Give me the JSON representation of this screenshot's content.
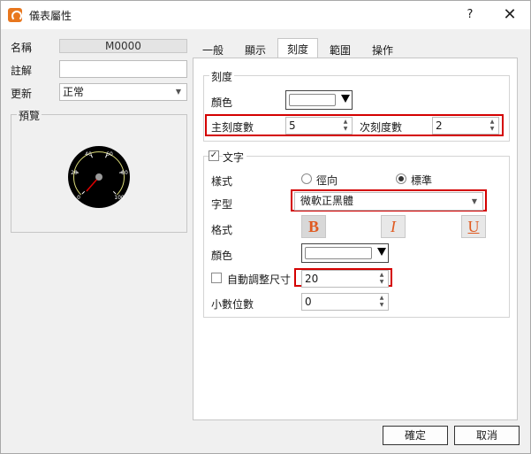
{
  "window": {
    "title": "儀表屬性",
    "help": "?",
    "close": "✕"
  },
  "left": {
    "name_label": "名稱",
    "name_value": "M0000",
    "comment_label": "註解",
    "comment_value": "",
    "update_label": "更新",
    "update_value": "正常",
    "preview_label": "預覽",
    "gauge_ticks": [
      "0",
      "20",
      "40",
      "60",
      "80",
      "100"
    ]
  },
  "tabs": [
    {
      "label": "一般"
    },
    {
      "label": "顯示"
    },
    {
      "label": "刻度"
    },
    {
      "label": "範圍"
    },
    {
      "label": "操作"
    }
  ],
  "scale": {
    "group_label": "刻度",
    "color_label": "顏色",
    "major_label": "主刻度數",
    "major_value": "5",
    "minor_label": "次刻度數",
    "minor_value": "2"
  },
  "text": {
    "group_label": "文字",
    "enabled": true,
    "style_label": "樣式",
    "radial_label": "徑向",
    "standard_label": "標準",
    "selected_style": "標準",
    "font_label": "字型",
    "font_value": "微軟正黑體",
    "format_label": "格式",
    "bold": "B",
    "italic": "I",
    "underline": "U",
    "color_label": "顏色",
    "autosize_label": "自動調整尺寸",
    "autosize_checked": false,
    "size_value": "20",
    "decimals_label": "小數位數",
    "decimals_value": "0"
  },
  "buttons": {
    "ok": "確定",
    "cancel": "取消"
  },
  "colors": {
    "highlight": "#d40000",
    "accent": "#e05a20",
    "gauge_face": "#000000",
    "gauge_needle": "#e00000"
  }
}
